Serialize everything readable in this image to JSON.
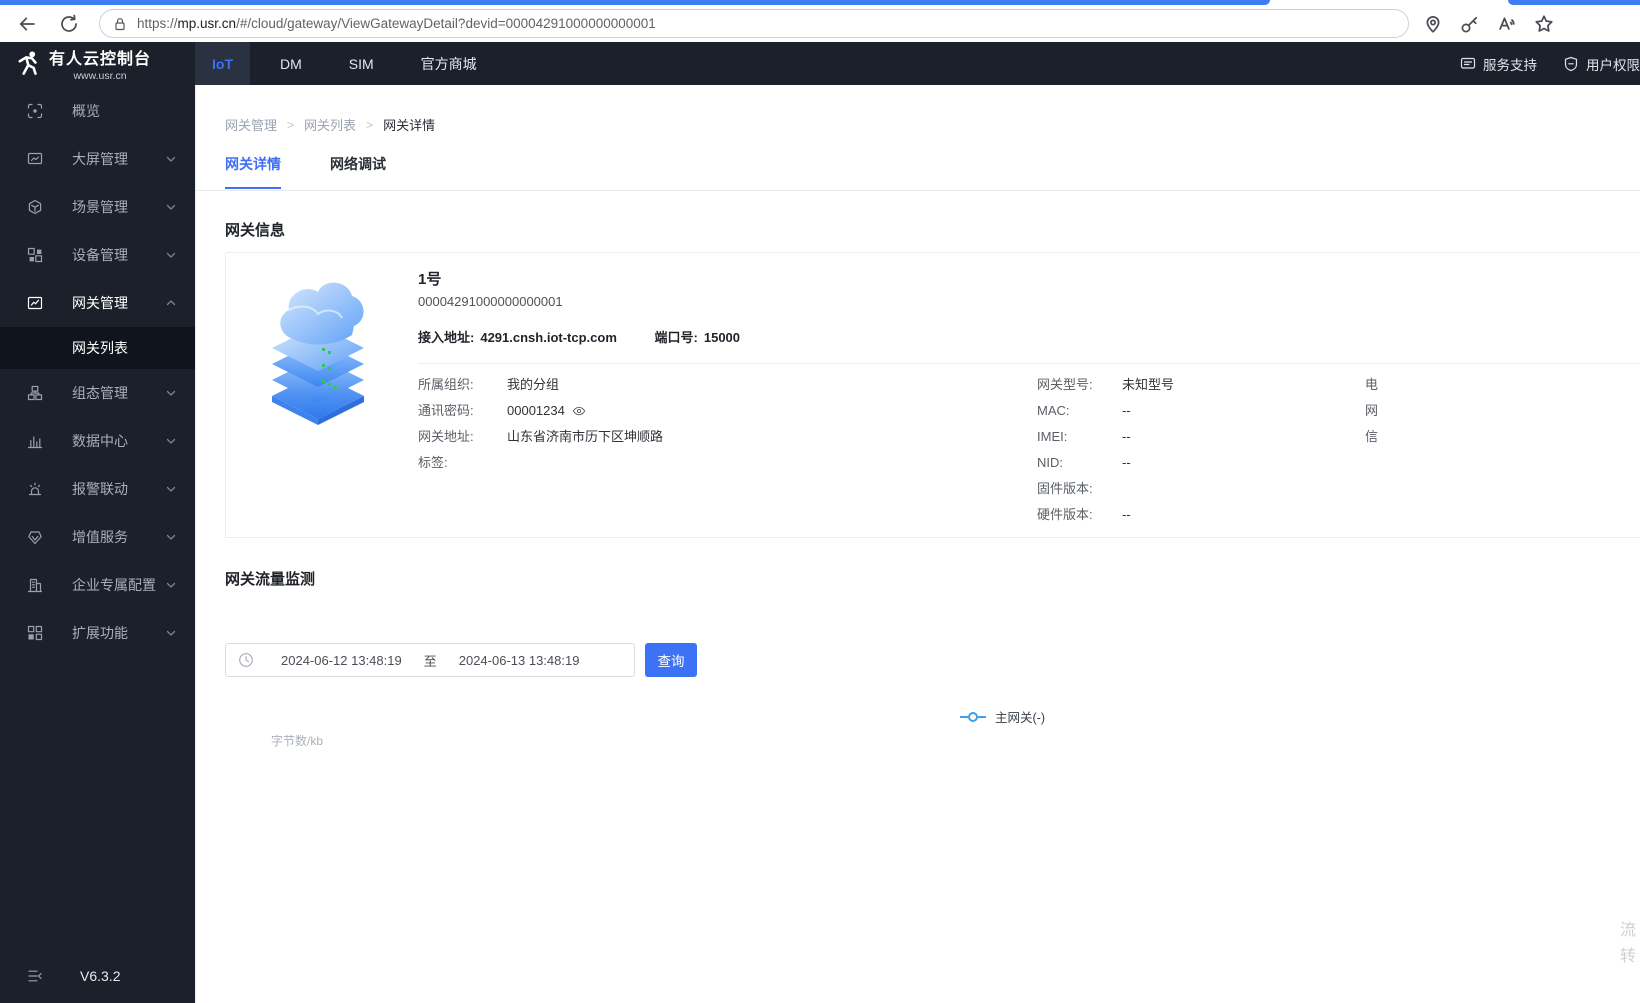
{
  "browser": {
    "url_scheme": "https://",
    "url_host": "mp.usr.cn",
    "url_path": "/#/cloud/gateway/ViewGatewayDetail?devid=00004291000000000001"
  },
  "topnav": {
    "logo_title": "有人云控制台",
    "logo_subtitle": "www.usr.cn",
    "tabs": [
      {
        "label": "IoT"
      },
      {
        "label": "DM"
      },
      {
        "label": "SIM"
      },
      {
        "label": "官方商城"
      }
    ],
    "support_label": "服务支持",
    "rights_label": "用户权限"
  },
  "sidebar": {
    "items": [
      {
        "label": "概览"
      },
      {
        "label": "大屏管理"
      },
      {
        "label": "场景管理"
      },
      {
        "label": "设备管理"
      },
      {
        "label": "网关管理"
      },
      {
        "label": "组态管理"
      },
      {
        "label": "数据中心"
      },
      {
        "label": "报警联动"
      },
      {
        "label": "增值服务"
      },
      {
        "label": "企业专属配置"
      },
      {
        "label": "扩展功能"
      }
    ],
    "submenu_item": "网关列表",
    "version": "V6.3.2"
  },
  "breadcrumb": {
    "items": [
      {
        "label": "网关管理"
      },
      {
        "label": "网关列表"
      },
      {
        "label": "网关详情"
      }
    ],
    "separator": ">"
  },
  "page_tabs": [
    {
      "label": "网关详情"
    },
    {
      "label": "网络调试"
    }
  ],
  "gateway_info": {
    "section_title": "网关信息",
    "name": "1号",
    "device_id": "00004291000000000001",
    "access_label": "接入地址:",
    "access_value": "4291.cnsh.iot-tcp.com",
    "port_label": "端口号:",
    "port_value": "15000",
    "fields_left": [
      {
        "label": "所属组织:",
        "value": "我的分组"
      },
      {
        "label": "通讯密码:",
        "value": "00001234"
      },
      {
        "label": "网关地址:",
        "value": "山东省济南市历下区坤顺路"
      },
      {
        "label": "标签:",
        "value": ""
      }
    ],
    "fields_right": [
      {
        "label": "网关型号:",
        "value": "未知型号"
      },
      {
        "label": "MAC:",
        "value": "--"
      },
      {
        "label": "IMEI:",
        "value": "--"
      },
      {
        "label": "NID:",
        "value": "--"
      },
      {
        "label": "固件版本:",
        "value": ""
      },
      {
        "label": "硬件版本:",
        "value": "--"
      }
    ],
    "fields_clipped": [
      {
        "label": "电"
      },
      {
        "label": "网"
      },
      {
        "label": "信"
      }
    ]
  },
  "traffic": {
    "section_title": "网关流量监测",
    "date_from": "2024-06-12 13:48:19",
    "date_separator": "至",
    "date_to": "2024-06-13 13:48:19",
    "query_label": "查询",
    "legend_label": "主网关(-)",
    "y_axis_label": "字节数/kb"
  },
  "floating_text": {
    "char1": "流",
    "char2": "转"
  },
  "colors": {
    "accent_blue": "#3E6FF5",
    "dark_nav": "#1C202B",
    "legend_blue": "#3BA0E9"
  }
}
